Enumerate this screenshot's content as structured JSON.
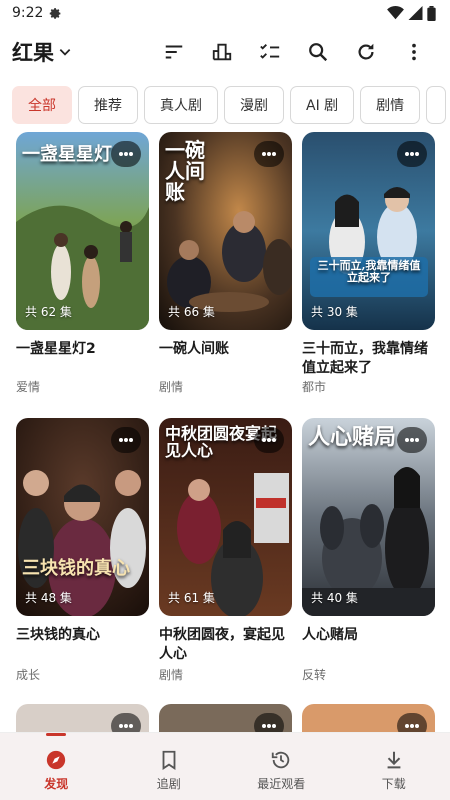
{
  "status": {
    "time": "9:22"
  },
  "toolbar": {
    "app_title": "红果"
  },
  "tabs": [
    {
      "label": "全部",
      "active": true
    },
    {
      "label": "推荐"
    },
    {
      "label": "真人剧"
    },
    {
      "label": "漫剧"
    },
    {
      "label": "AI 剧"
    },
    {
      "label": "剧情"
    }
  ],
  "cards": [
    {
      "title": "一盏星星灯2",
      "episodes": "共 62 集",
      "genre": "爱情",
      "poster_text": "一盏星星灯"
    },
    {
      "title": "一碗人间账",
      "episodes": "共 66 集",
      "genre": "剧情",
      "poster_text": "一碗人间账"
    },
    {
      "title": "三十而立，我靠情绪值立起来了",
      "episodes": "共 30 集",
      "genre": "都市",
      "poster_text": "三十而立,我靠情绪值立起来了"
    },
    {
      "title": "三块钱的真心",
      "episodes": "共 48 集",
      "genre": "成长",
      "poster_text": "三块钱的真心"
    },
    {
      "title": "中秋团圆夜，宴起见人心",
      "episodes": "共 61 集",
      "genre": "剧情",
      "poster_text": "中秋团圆夜宴起见人心"
    },
    {
      "title": "人心赌局",
      "episodes": "共 40 集",
      "genre": "反转",
      "poster_text": "人心赌局"
    }
  ],
  "bottom_nav": [
    {
      "label": "发现",
      "icon": "compass-icon",
      "active": true
    },
    {
      "label": "追剧",
      "icon": "bookmark-icon"
    },
    {
      "label": "最近观看",
      "icon": "history-icon"
    },
    {
      "label": "下载",
      "icon": "download-icon"
    }
  ],
  "colors": {
    "accent": "#c9362b",
    "tab_active_bg": "#fbe3df",
    "nav_bg": "#f6f1f1"
  }
}
